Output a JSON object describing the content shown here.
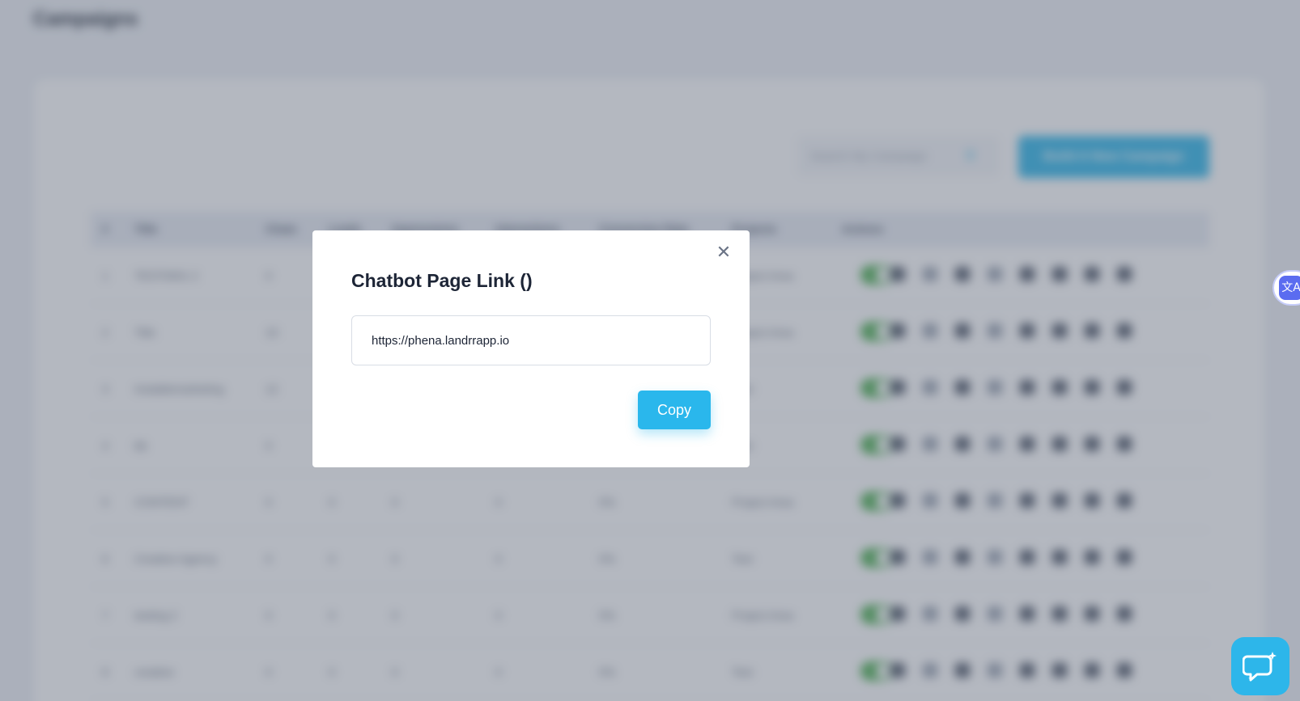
{
  "background": {
    "page_title": "Campaigns",
    "search": {
      "placeholder": "Search My Campaign"
    },
    "build_button_label": "Build A New Campaign",
    "table": {
      "headers": [
        "#",
        "Title",
        "Chats",
        "Leads",
        "Impressions",
        "Interactions",
        "Conversion Rate",
        "Projects",
        "Actions"
      ],
      "rows": [
        {
          "num": "1",
          "title": "TEST0001 2",
          "chats": "0",
          "leads": "",
          "impressions": "",
          "interactions": "",
          "conversion": "",
          "project": "Project Area"
        },
        {
          "num": "2",
          "title": "Title",
          "chats": "10",
          "leads": "",
          "impressions": "",
          "interactions": "",
          "conversion": "",
          "project": "Project Area"
        },
        {
          "num": "3",
          "title": "Instablemarketing",
          "chats": "12",
          "leads": "",
          "impressions": "",
          "interactions": "",
          "conversion": "",
          "project": "Test"
        },
        {
          "num": "4",
          "title": "bb",
          "chats": "0",
          "leads": "",
          "impressions": "",
          "interactions": "",
          "conversion": "",
          "project": "Test"
        },
        {
          "num": "5",
          "title": "CONTENT",
          "chats": "0",
          "leads": "0",
          "impressions": "0",
          "interactions": "0",
          "conversion": "0%",
          "project": "Project Area"
        },
        {
          "num": "6",
          "title": "Creative Agency",
          "chats": "0",
          "leads": "0",
          "impressions": "0",
          "interactions": "0",
          "conversion": "0%",
          "project": "Test"
        },
        {
          "num": "7",
          "title": "testing 2",
          "chats": "0",
          "leads": "0",
          "impressions": "0",
          "interactions": "0",
          "conversion": "0%",
          "project": "Project Area"
        },
        {
          "num": "8",
          "title": "creative",
          "chats": "0",
          "leads": "0",
          "impressions": "0",
          "interactions": "0",
          "conversion": "0%",
          "project": "Test"
        }
      ]
    }
  },
  "modal": {
    "title": "Chatbot Page Link ()",
    "link_value": "https://phena.landrrapp.io",
    "copy_label": "Copy",
    "close_icon": "close-icon"
  },
  "widgets": {
    "translate_icon": "translate-icon",
    "translate_glyph": "文A",
    "chat_icon": "chat-support-icon"
  },
  "colors": {
    "accent": "#2ab7ec",
    "toggle_on": "#4caf50",
    "overlay": "#586274"
  }
}
